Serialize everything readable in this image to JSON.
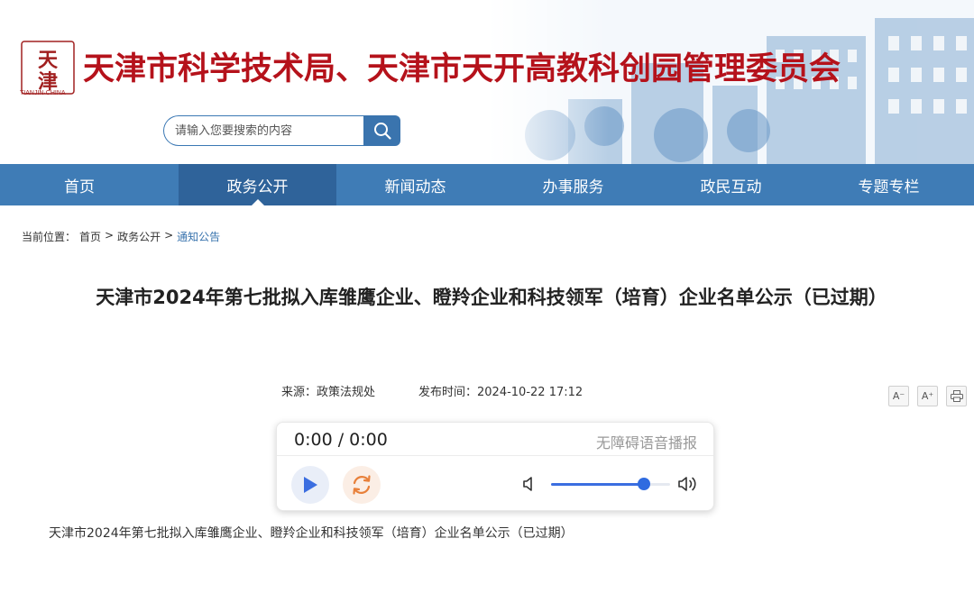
{
  "header": {
    "logo_chars": "天津",
    "logo_sub": "TIANJIN·CHINA",
    "site_title": "天津市科学技术局、天津市天开高教科创园管理委员会",
    "search_placeholder": "请输入您要搜索的内容",
    "search_icon": "search-icon"
  },
  "nav": {
    "items": [
      {
        "label": "首页"
      },
      {
        "label": "政务公开",
        "active": true
      },
      {
        "label": "新闻动态"
      },
      {
        "label": "办事服务"
      },
      {
        "label": "政民互动"
      },
      {
        "label": "专题专栏"
      }
    ]
  },
  "breadcrumb": {
    "prefix": "当前位置：",
    "items": [
      "首页",
      "政务公开",
      "通知公告"
    ],
    "sep": ">"
  },
  "article": {
    "title": "天津市2024年第七批拟入库雏鹰企业、瞪羚企业和科技领军（培育）企业名单公示（已过期）",
    "source": "来源：政策法规处",
    "publish_time": "发布时间：2024-10-22 17:12",
    "body": "天津市2024年第七批拟入库雏鹰企业、瞪羚企业和科技领军（培育）企业名单公示（已过期）"
  },
  "tools": {
    "decrease": "A⁻",
    "increase": "A⁺",
    "print_icon": "print-icon"
  },
  "player": {
    "time": "0:00 / 0:00",
    "label": "无障碍语音播报",
    "volume_percent": 78,
    "colors": {
      "play": "#3b6ee0",
      "replay": "#e8803a"
    }
  },
  "colors": {
    "brand_red": "#b5121b",
    "nav_blue": "#3f7cb6",
    "nav_active": "#2f639a"
  }
}
